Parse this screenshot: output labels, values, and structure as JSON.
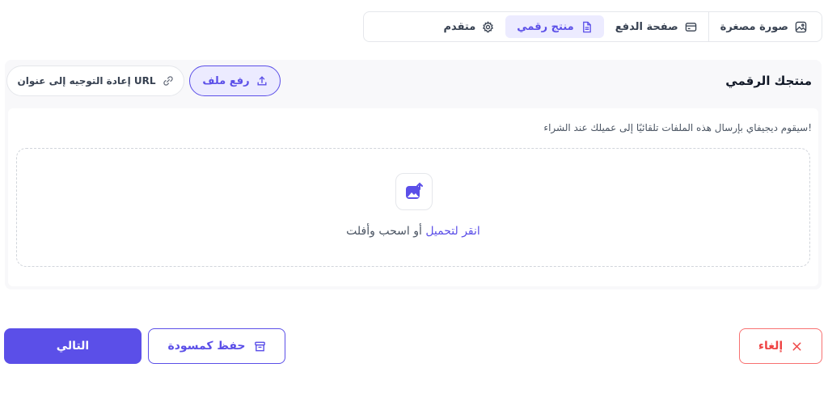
{
  "tabs": [
    {
      "label": "صورة مصغرة",
      "icon": "image-icon",
      "active": false
    },
    {
      "label": "صفحة الدفع",
      "icon": "credit-card-icon",
      "active": false
    },
    {
      "label": "منتج رقمي",
      "icon": "file-icon",
      "active": true
    },
    {
      "label": "متقدم",
      "icon": "gear-icon",
      "active": false
    }
  ],
  "card": {
    "title": "منتجك الرقمي",
    "upload_button": "رفع ملف",
    "redirect_button": "إعادة التوجيه إلى عنوان URL",
    "hint": "سيقوم ديجيفاي بإرسال هذه الملفات تلقائيًا إلى عميلك عند الشراء!",
    "dropzone": {
      "link_text": "انقر لتحميل",
      "rest_text": " أو اسحب وأفلت"
    }
  },
  "footer": {
    "next": "التالي",
    "save_draft": "حفظ كمسودة",
    "cancel": "إلغاء"
  },
  "colors": {
    "accent": "#5b4fe8",
    "danger": "#ef4444"
  }
}
